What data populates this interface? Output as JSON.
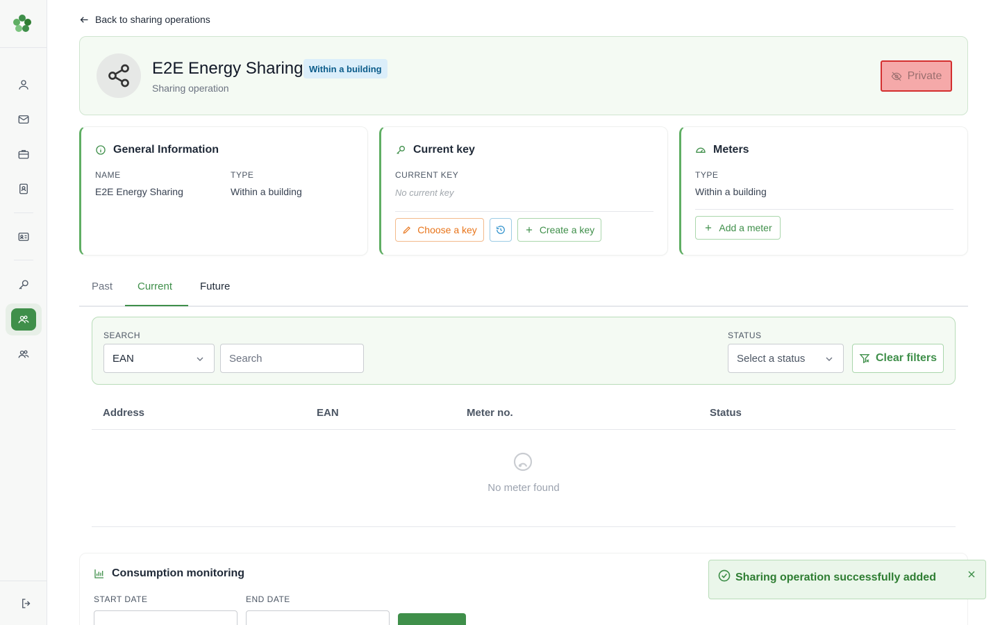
{
  "nav": {
    "back_label": "Back to sharing operations"
  },
  "header": {
    "title": "E2E Energy Sharing",
    "badge": "Within a building",
    "subtitle": "Sharing operation",
    "private_label": "Private"
  },
  "general": {
    "title": "General Information",
    "name_label": "NAME",
    "name_value": "E2E Energy Sharing",
    "type_label": "TYPE",
    "type_value": "Within a building"
  },
  "current_key": {
    "title": "Current key",
    "key_label": "CURRENT KEY",
    "key_value": "No current key",
    "choose_label": "Choose a key",
    "create_label": "Create a key"
  },
  "meters": {
    "title": "Meters",
    "type_label": "TYPE",
    "type_value": "Within a building",
    "add_label": "Add a meter"
  },
  "tabs": [
    {
      "label": "Past"
    },
    {
      "label": "Current"
    },
    {
      "label": "Future"
    }
  ],
  "filters": {
    "search_label": "SEARCH",
    "field_select": "EAN",
    "search_placeholder": "Search",
    "status_label": "STATUS",
    "status_placeholder": "Select a status",
    "clear_label": "Clear filters"
  },
  "table": {
    "columns": [
      "Address",
      "EAN",
      "Meter no.",
      "Status"
    ],
    "empty_text": "No meter found"
  },
  "consumption": {
    "title": "Consumption monitoring",
    "start_label": "START DATE",
    "end_label": "END DATE"
  },
  "toast": {
    "message": "Sharing operation successfully added"
  },
  "colors": {
    "accent": "#3f8f4a",
    "private_bg": "#f5a9a9",
    "private_border": "#d32f2f",
    "badge_bg": "#dbeefa"
  }
}
